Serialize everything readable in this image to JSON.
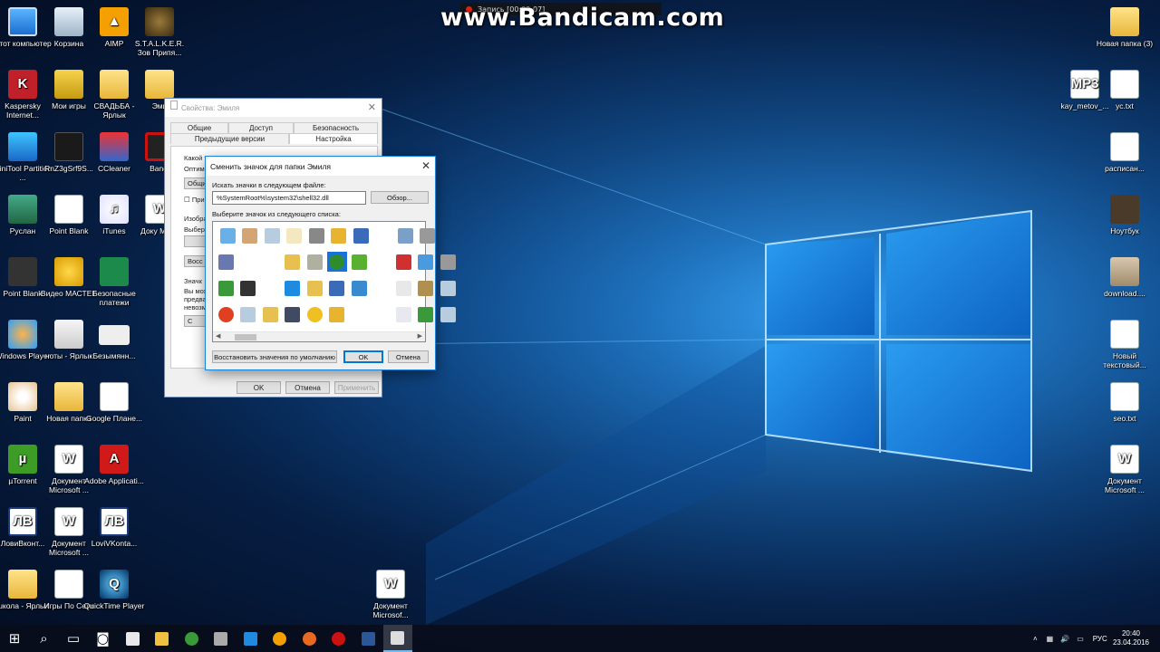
{
  "watermark": {
    "text": "www.Bandicam.com",
    "rec_time": "Запись [00:02:07]"
  },
  "desktop_left": [
    {
      "label": "Этот компьютер",
      "icon": "computer-icon"
    },
    {
      "label": "Корзина",
      "icon": "recycle-bin-icon"
    },
    {
      "label": "AIMP",
      "icon": "aimp-icon"
    },
    {
      "label": "S.T.A.L.K.E.R. Зов Припя...",
      "icon": "stalker-icon"
    },
    {
      "label": "Kaspersky Internet...",
      "icon": "kaspersky-icon"
    },
    {
      "label": "Мои игры",
      "icon": "lock-folder-icon"
    },
    {
      "label": "СВАДЬБА - Ярлык",
      "icon": "folder-shortcut-icon"
    },
    {
      "label": "Эми",
      "icon": "folder-icon"
    },
    {
      "label": "MiniTool Partition ...",
      "icon": "minitool-icon"
    },
    {
      "label": "RnZ3gSrf9S...",
      "icon": "dark-file-icon"
    },
    {
      "label": "CCleaner",
      "icon": "ccleaner-icon"
    },
    {
      "label": "Bandi",
      "icon": "bandicam-icon"
    },
    {
      "label": "Руслан",
      "icon": "user-folder-icon"
    },
    {
      "label": "Point Blank",
      "icon": "document-icon"
    },
    {
      "label": "iTunes",
      "icon": "itunes-icon"
    },
    {
      "label": "Доку Micro",
      "icon": "word-document-icon"
    },
    {
      "label": "Point Blank",
      "icon": "point-blank-icon"
    },
    {
      "label": "Видео МАСТЕР",
      "icon": "video-master-icon"
    },
    {
      "label": "Безопасные платежи",
      "icon": "safe-payments-icon"
    },
    {
      "label": "Windows Player",
      "icon": "windows-player-icon"
    },
    {
      "label": "ноты - Ярлык",
      "icon": "notes-shortcut-icon"
    },
    {
      "label": "Безымянн...",
      "icon": "untitled-image-icon"
    },
    {
      "label": "Paint",
      "icon": "paint-icon"
    },
    {
      "label": "Новая папка",
      "icon": "folder-icon"
    },
    {
      "label": "Google Плане...",
      "icon": "google-planet-icon"
    },
    {
      "label": "µTorrent",
      "icon": "utorrent-icon"
    },
    {
      "label": "Документ Microsoft ...",
      "icon": "word-document-icon"
    },
    {
      "label": "Adobe Applicati...",
      "icon": "adobe-icon"
    },
    {
      "label": "ЛовиВконт...",
      "icon": "lovivkontakte-icon"
    },
    {
      "label": "Документ Microsoft ...",
      "icon": "word-document-icon"
    },
    {
      "label": "LoviVKonta...",
      "icon": "lovivkontakte-icon"
    },
    {
      "label": "школа - Ярлык",
      "icon": "folder-shortcut-icon"
    },
    {
      "label": "Игры По Сети",
      "icon": "document-icon"
    },
    {
      "label": "QuickTime Player",
      "icon": "quicktime-icon"
    },
    {
      "label": "Документ Microsof...",
      "icon": "word-document-icon"
    }
  ],
  "desktop_right": [
    {
      "label": "Новая папка (3)",
      "icon": "folder-icon"
    },
    {
      "label": "kay_metov_...",
      "icon": "mp3-file-icon"
    },
    {
      "label": "ус.txt",
      "icon": "text-file-icon"
    },
    {
      "label": "расписан...",
      "icon": "text-file-icon"
    },
    {
      "label": "Ноутбук",
      "icon": "book-icon"
    },
    {
      "label": "download....",
      "icon": "download-image-icon"
    },
    {
      "label": "Новый текстовый...",
      "icon": "text-file-icon"
    },
    {
      "label": "seo.txt",
      "icon": "text-file-icon"
    },
    {
      "label": "Документ Microsoft ...",
      "icon": "word-document-icon"
    }
  ],
  "properties": {
    "title": "Свойства: Эмиля",
    "tabs_row1": [
      "Общие",
      "Доступ",
      "Безопасность"
    ],
    "tabs_row2": [
      "Предыдущие версии",
      "Настройка"
    ],
    "fragments": [
      "Какой тип папки вы хотите?",
      "Оптим",
      "Общие",
      "При",
      "Изобра",
      "Выбери",
      "Восс",
      "Значк",
      "Вы мож",
      "предва",
      "невозм",
      "С"
    ],
    "ok": "OK",
    "cancel": "Отмена",
    "apply": "Применить"
  },
  "dialog": {
    "title": "Сменить значок для папки Эмиля",
    "search_label": "Искать значки в следующем файле:",
    "path": "%SystemRoot%\\system32\\shell32.dll",
    "browse": "Обзор...",
    "list_label": "Выберите значок из следующего списка:",
    "restore": "Восстановить значения по умолчанию",
    "ok": "OK",
    "cancel": "Отмена"
  },
  "icon_grid": [
    "card-icon",
    "hand-icon",
    "recycle-icon",
    "blank-doc-icon",
    "printer-icon",
    "key-folder-icon",
    "network-pc-icon",
    "blank-icon",
    "search-pc-icon",
    "fax-icon",
    "cube-icon",
    "shortcut-arrow-icon",
    "blank-icon",
    "folder-gear-icon",
    "drive-icon",
    "tree-icon",
    "upload-icon",
    "blank-icon",
    "help-card-icon",
    "monitor-card-icon",
    "printer-small-icon",
    "back-arrow-icon",
    "camera-icon",
    "blank-icon",
    "blue-rect-icon",
    "font-folder-icon",
    "pc-icon",
    "network-arrow-icon",
    "blank-icon",
    "copy-icon",
    "lock-drive-icon",
    "recycle-small-icon",
    "power-icon",
    "recycle-icon",
    "folder-grid-icon",
    "keyboard-icon",
    "star-icon",
    "padlock-icon",
    "blank-icon",
    "blank-icon",
    "magnifier-doc-icon",
    "green-down-icon",
    "recycle-small-icon"
  ],
  "taskbar": {
    "items": [
      "start-icon",
      "search-icon",
      "task-view-icon",
      "store-icon",
      "media-icon",
      "explorer-icon",
      "chrome-icon",
      "network-icon",
      "edge-icon",
      "aimp-icon",
      "firefox-icon",
      "bandicam-icon",
      "word-icon",
      "explorer-active-icon"
    ],
    "lang": "РУС",
    "time": "20:40",
    "date": "23.04.2016"
  }
}
